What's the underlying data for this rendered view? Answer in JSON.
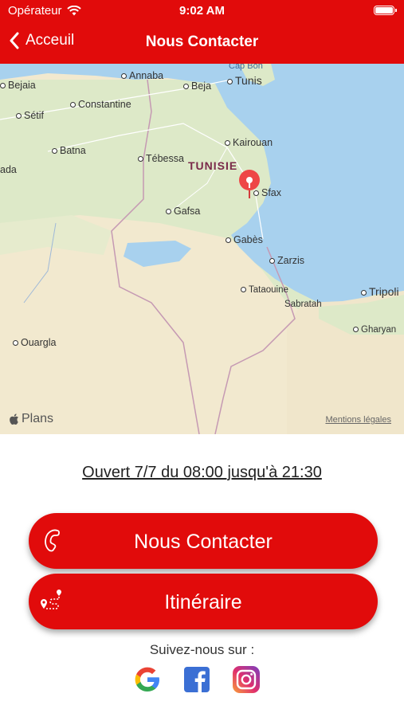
{
  "status_bar": {
    "carrier": "Opérateur",
    "time": "9:02 AM"
  },
  "nav": {
    "back_label": "Acceuil",
    "title": "Nous Contacter"
  },
  "map": {
    "country_label": "TUNISIE",
    "cities": [
      "Cap Bon",
      "Bejaia",
      "Annaba",
      "Beja",
      "Tunis",
      "Constantine",
      "Sétif",
      "Batna",
      "Kairouan",
      "Tébessa",
      "ada",
      "Sfax",
      "Gafsa",
      "Gabès",
      "Zarzis",
      "Tataouine",
      "Tripoli",
      "Sabratah",
      "Gharyan",
      "Ouargla"
    ],
    "attribution": "Plans",
    "legal": "Mentions légales"
  },
  "hours_text": "Ouvert 7/7 du 08:00 jusqu'à 21:30",
  "buttons": {
    "contact_label": "Nous Contacter",
    "itinerary_label": "Itinéraire"
  },
  "follow_label": "Suivez-nous sur :",
  "icons": {
    "back": "chevron-left-icon",
    "map_pin": "map-pin-icon",
    "contact": "phone-icon",
    "itinerary": "route-icon",
    "social": [
      "google-icon",
      "facebook-icon",
      "instagram-icon"
    ]
  },
  "colors": {
    "brand_red": "#e10b0b",
    "sea": "#a8d1ee",
    "land": "#f2e9cf",
    "green": "#d6e8c4"
  }
}
